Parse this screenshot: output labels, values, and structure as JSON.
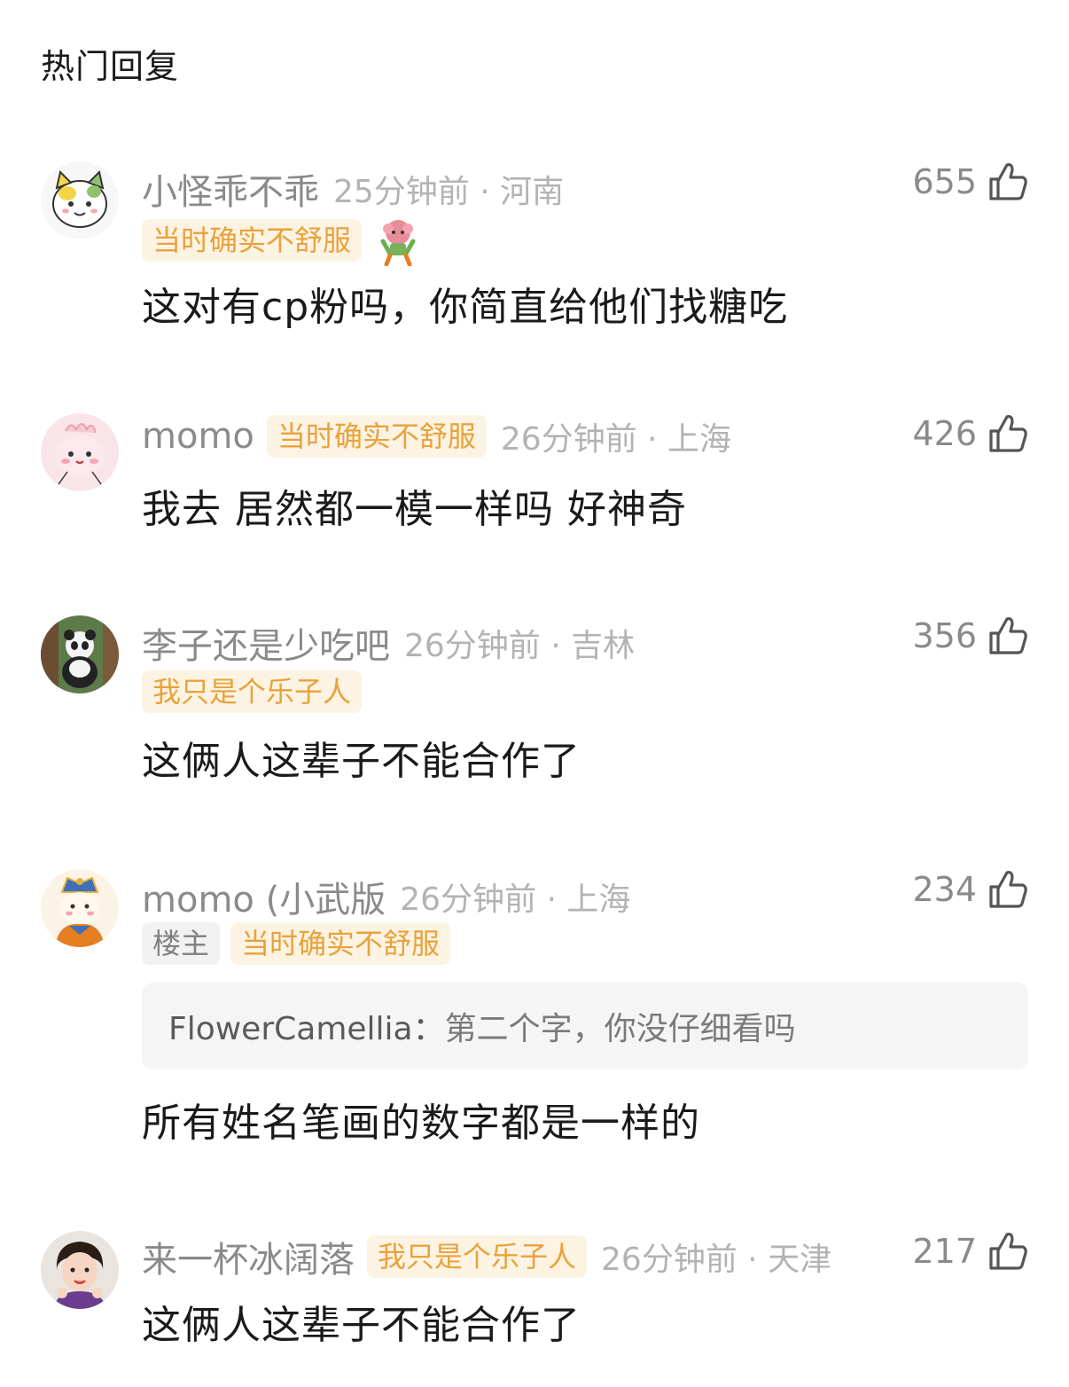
{
  "section_title": "热门回复",
  "comments": [
    {
      "username": "小怪乖不乖",
      "meta": "25分钟前 · 河南",
      "tag": "当时确实不舒服",
      "likes": "655",
      "text": "这对有cp粉吗，你简直给他们找糖吃",
      "avatar": "cat-avatar",
      "sticker": "fluffy-sticker"
    },
    {
      "username": "momo",
      "meta": "26分钟前 · 上海",
      "tag": "当时确实不舒服",
      "likes": "426",
      "text": "我去 居然都一模一样吗 好神奇",
      "avatar": "pink-bunny-avatar"
    },
    {
      "username": "李子还是少吃吧",
      "meta": "26分钟前 · 吉林",
      "tag": "我只是个乐子人",
      "likes": "356",
      "text": "这俩人这辈子不能合作了",
      "avatar": "panda-avatar"
    },
    {
      "username": "momo (小武版",
      "meta": "26分钟前 · 上海",
      "owner_tag": "楼主",
      "tag": "当时确实不舒服",
      "likes": "234",
      "reply_user": "FlowerCamellia：",
      "reply_text": "第二个字，你没仔细看吗",
      "text": "所有姓名笔画的数字都是一样的",
      "avatar": "character-avatar"
    },
    {
      "username": "来一杯冰阔落",
      "meta": "26分钟前 · 天津",
      "tag": "我只是个乐子人",
      "likes": "217",
      "text": "这俩人这辈子不能合作了",
      "avatar": "girl-avatar"
    }
  ],
  "colors": {
    "tag_bg": "#fdf3e3",
    "tag_text": "#e9a23b",
    "username": "#8a8a8a",
    "meta": "#b3b3b3",
    "body": "#1a1a1a"
  },
  "icons": {
    "like": "thumbs-up-icon"
  }
}
